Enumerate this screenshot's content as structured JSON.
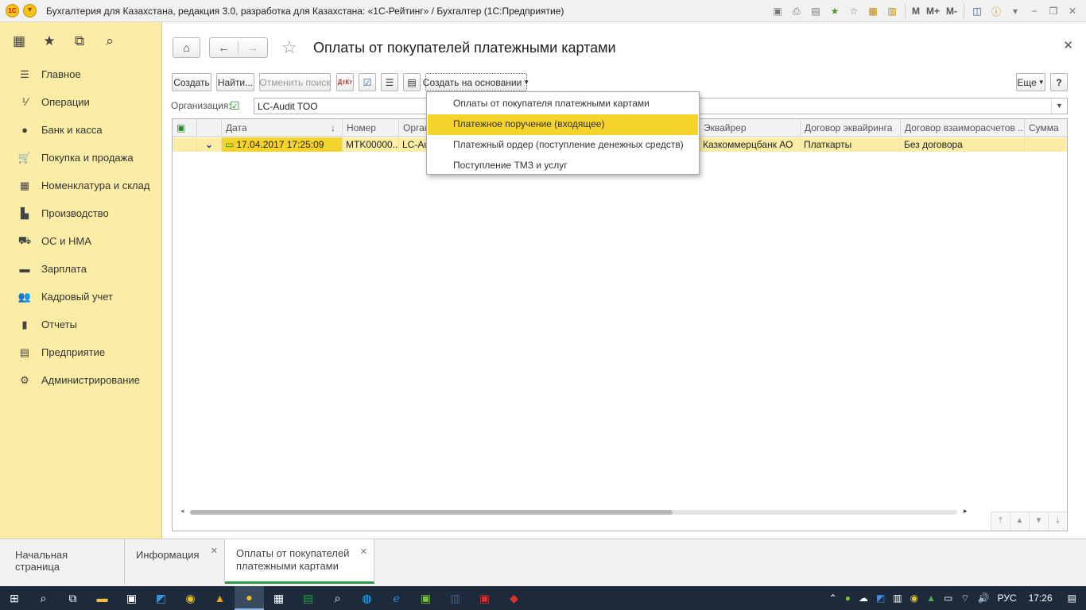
{
  "titlebar": {
    "title": "Бухгалтерия для Казахстана, редакция 3.0, разработка для Казахстана: «1С-Рейтинг» / Бухгалтер  (1С:Предприятие)",
    "logo": "1С",
    "mem_m": "M",
    "mem_mplus": "M+",
    "mem_mminus": "M-"
  },
  "sidebar": {
    "items": [
      {
        "label": "Главное",
        "icon": "menu-lines-icon"
      },
      {
        "label": "Операции",
        "icon": "dt-kt-icon"
      },
      {
        "label": "Банк и касса",
        "icon": "tenge-icon"
      },
      {
        "label": "Покупка и продажа",
        "icon": "cart-icon"
      },
      {
        "label": "Номенклатура и склад",
        "icon": "grid-icon"
      },
      {
        "label": "Производство",
        "icon": "factory-icon"
      },
      {
        "label": "ОС и НМА",
        "icon": "truck-icon"
      },
      {
        "label": "Зарплата",
        "icon": "wallet-icon"
      },
      {
        "label": "Кадровый учет",
        "icon": "people-icon"
      },
      {
        "label": "Отчеты",
        "icon": "bar-chart-icon"
      },
      {
        "label": "Предприятие",
        "icon": "building-icon"
      },
      {
        "label": "Администрирование",
        "icon": "gear-icon"
      }
    ]
  },
  "main": {
    "page_title": "Оплаты от покупателей платежными картами",
    "toolbar": {
      "create": "Создать",
      "find": "Найти...",
      "cancel_search": "Отменить поиск",
      "create_based_on": "Создать на основании",
      "more": "Еще",
      "help": "?"
    },
    "organization": {
      "label": "Организация:",
      "value": "LC-Audit TOO"
    },
    "table": {
      "columns": [
        "Дата",
        "Номер",
        "Орган",
        "Эквайрер",
        "Договор эквайринга",
        "Договор взаиморасчетов ...",
        "Сумма"
      ],
      "rows": [
        {
          "date": "17.04.2017 17:25:09",
          "number": "MTK00000...",
          "org": "LC-Au",
          "acquirer": "Казкоммерцбанк АО",
          "acquiring_contract": "Платкарты",
          "settlement_contract": "Без договора",
          "sum": ""
        }
      ]
    },
    "dropdown": {
      "items": [
        "Оплаты от покупателя платежными картами",
        "Платежное поручение (входящее)",
        "Платежный ордер (поступление денежных средств)",
        "Поступление ТМЗ и услуг"
      ],
      "active_index": 1
    }
  },
  "tabs": [
    {
      "label": "Начальная страница"
    },
    {
      "label": "Информация"
    },
    {
      "label": "Оплаты от покупателей платежными картами"
    }
  ],
  "taskbar": {
    "language": "РУС",
    "time": "17:26"
  },
  "colors": {
    "sidebar_bg": "#fbeca6",
    "highlight": "#f5d32a",
    "active_tab_accent": "#2a9a4a"
  }
}
